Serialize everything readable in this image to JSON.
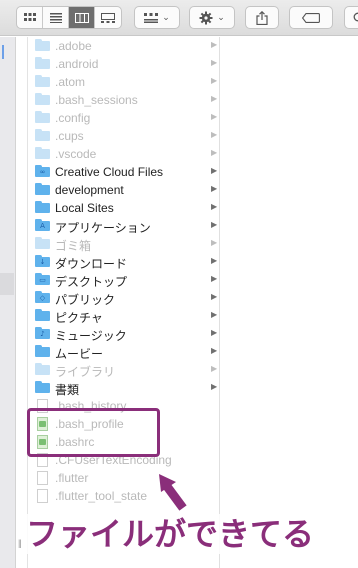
{
  "toolbar": {
    "view_buttons": [
      {
        "icon": "icon-view-icon",
        "active": false
      },
      {
        "icon": "list-view-icon",
        "active": false
      },
      {
        "icon": "column-view-icon",
        "active": true
      },
      {
        "icon": "gallery-view-icon",
        "active": false
      }
    ],
    "group_icon": "group-by-icon",
    "action_icon": "gear-icon",
    "share_icon": "share-icon",
    "tag_icon": "tag-icon"
  },
  "files": [
    {
      "name": ".adobe",
      "kind": "folder",
      "dim": true,
      "has_arrow": true,
      "folder_color": "#c7e2f6"
    },
    {
      "name": ".android",
      "kind": "folder",
      "dim": true,
      "has_arrow": true,
      "folder_color": "#c7e2f6"
    },
    {
      "name": ".atom",
      "kind": "folder",
      "dim": true,
      "has_arrow": true,
      "folder_color": "#c7e2f6"
    },
    {
      "name": ".bash_sessions",
      "kind": "folder",
      "dim": true,
      "has_arrow": true,
      "folder_color": "#c7e2f6"
    },
    {
      "name": ".config",
      "kind": "folder",
      "dim": true,
      "has_arrow": true,
      "folder_color": "#c7e2f6"
    },
    {
      "name": ".cups",
      "kind": "folder",
      "dim": true,
      "has_arrow": true,
      "folder_color": "#c7e2f6"
    },
    {
      "name": ".vscode",
      "kind": "folder",
      "dim": true,
      "has_arrow": true,
      "folder_color": "#c7e2f6"
    },
    {
      "name": "Creative Cloud Files",
      "kind": "folder",
      "dim": false,
      "has_arrow": true,
      "folder_color": "#5fb2ec",
      "glyph": "∞"
    },
    {
      "name": "development",
      "kind": "folder",
      "dim": false,
      "has_arrow": true,
      "folder_color": "#5fb2ec"
    },
    {
      "name": "Local Sites",
      "kind": "folder",
      "dim": false,
      "has_arrow": true,
      "folder_color": "#5fb2ec"
    },
    {
      "name": "アプリケーション",
      "kind": "folder",
      "dim": false,
      "has_arrow": true,
      "folder_color": "#5fb2ec",
      "glyph": "A"
    },
    {
      "name": "ゴミ箱",
      "kind": "folder",
      "dim": true,
      "has_arrow": true,
      "folder_color": "#c7e2f6"
    },
    {
      "name": "ダウンロード",
      "kind": "folder",
      "dim": false,
      "has_arrow": true,
      "folder_color": "#5fb2ec",
      "glyph": "↓"
    },
    {
      "name": "デスクトップ",
      "kind": "folder",
      "dim": false,
      "has_arrow": true,
      "folder_color": "#5fb2ec",
      "glyph": "▭"
    },
    {
      "name": "パブリック",
      "kind": "folder",
      "dim": false,
      "has_arrow": true,
      "folder_color": "#5fb2ec",
      "glyph": "◇"
    },
    {
      "name": "ピクチャ",
      "kind": "folder",
      "dim": false,
      "has_arrow": true,
      "folder_color": "#5fb2ec"
    },
    {
      "name": "ミュージック",
      "kind": "folder",
      "dim": false,
      "has_arrow": true,
      "folder_color": "#5fb2ec",
      "glyph": "♪"
    },
    {
      "name": "ムービー",
      "kind": "folder",
      "dim": false,
      "has_arrow": true,
      "folder_color": "#5fb2ec"
    },
    {
      "name": "ライブラリ",
      "kind": "folder",
      "dim": true,
      "has_arrow": true,
      "folder_color": "#c7e2f6"
    },
    {
      "name": "書類",
      "kind": "folder",
      "dim": false,
      "has_arrow": true,
      "folder_color": "#5fb2ec"
    },
    {
      "name": ".bash_history",
      "kind": "doc",
      "dim": true,
      "has_arrow": false
    },
    {
      "name": ".bash_profile",
      "kind": "doc-green",
      "dim": true,
      "has_arrow": false
    },
    {
      "name": ".bashrc",
      "kind": "doc-green",
      "dim": true,
      "has_arrow": false
    },
    {
      "name": ".CFUserTextEncoding",
      "kind": "doc",
      "dim": true,
      "has_arrow": false
    },
    {
      "name": ".flutter",
      "kind": "doc",
      "dim": true,
      "has_arrow": false
    },
    {
      "name": ".flutter_tool_state",
      "kind": "doc",
      "dim": true,
      "has_arrow": false
    }
  ],
  "annotation": {
    "text": "ファイルができてる",
    "color": "#8a2e7a"
  }
}
